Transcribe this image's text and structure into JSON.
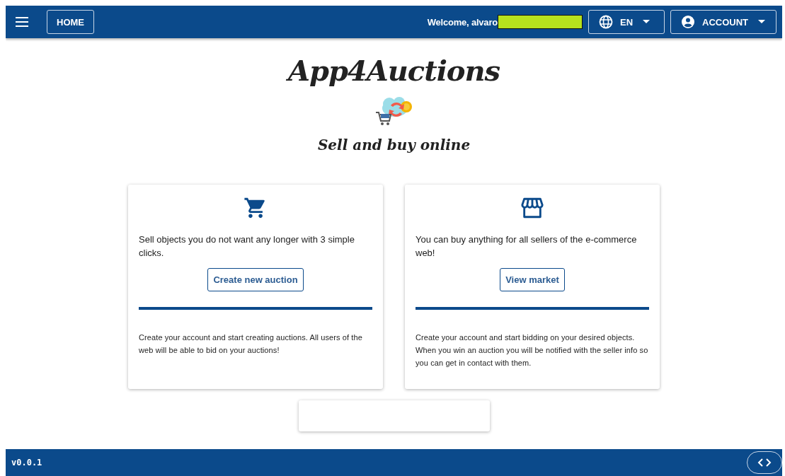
{
  "header": {
    "home_button": "HOME",
    "welcome": "Welcome, alvaro",
    "language": "EN",
    "account": "ACCOUNT"
  },
  "hero": {
    "title": "App4Auctions",
    "subtitle": "Sell and buy online"
  },
  "cards": [
    {
      "kind": "cart",
      "text": "Sell objects you do not want any longer with 3 simple clicks.",
      "button": "Create new auction",
      "note": "Create your account and start creating auctions. All users of the web will be able to bid on your auctions!"
    },
    {
      "kind": "store",
      "text": "You can buy anything for all sellers of the e-commerce web!",
      "button": "View market",
      "note": "Create your account and start bidding on your desired objects. When you win an auction you will be notified with the seller info so you can get in contact with them."
    }
  ],
  "footer": {
    "version": "v0.0.1"
  }
}
